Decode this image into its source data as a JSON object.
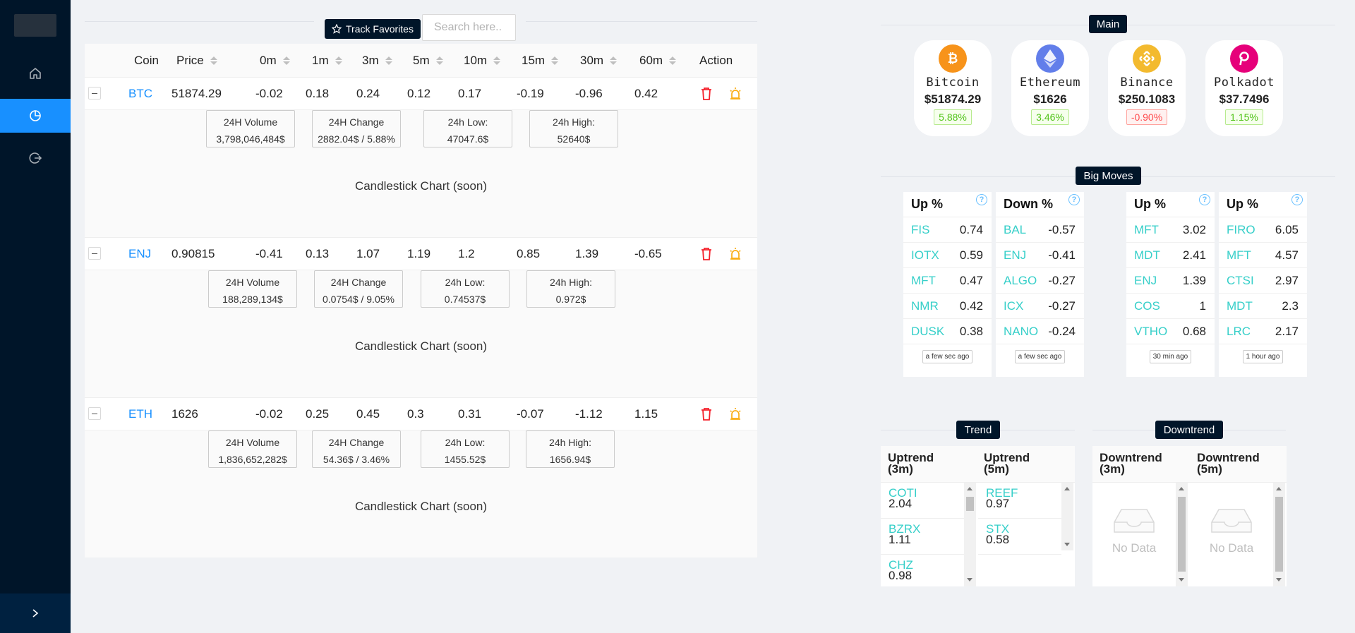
{
  "sidebar": {
    "items": [
      {
        "icon": "home-icon"
      },
      {
        "icon": "pie-chart-icon"
      },
      {
        "icon": "logout-icon"
      }
    ],
    "trigger_icon": "chevron-right-icon"
  },
  "toolbar": {
    "track_label": "Track Favorites",
    "search_placeholder": "Search here.."
  },
  "table": {
    "headers": {
      "coin": "Coin",
      "price": "Price",
      "m0": "0m",
      "m1": "1m",
      "m3": "3m",
      "m5": "5m",
      "m10": "10m",
      "m15": "15m",
      "m30": "30m",
      "m60": "60m",
      "action": "Action"
    },
    "rows": [
      {
        "coin": "BTC",
        "price": "51874.29",
        "m0": "-0.02",
        "m1": "0.18",
        "m3": "0.24",
        "m5": "0.12",
        "m10": "0.17",
        "m15": "-0.19",
        "m30": "-0.96",
        "m60": "0.42",
        "stats": [
          {
            "label": "24H Volume",
            "value": "3,798,046,484$"
          },
          {
            "label": "24H Change",
            "value": "2882.04$ / 5.88%"
          },
          {
            "label": "24h Low:",
            "value": "47047.6$"
          },
          {
            "label": "24h High:",
            "value": "52640$"
          }
        ],
        "chart_label": "Candlestick Chart (soon)"
      },
      {
        "coin": "ENJ",
        "price": "0.90815",
        "m0": "-0.41",
        "m1": "0.13",
        "m3": "1.07",
        "m5": "1.19",
        "m10": "1.2",
        "m15": "0.85",
        "m30": "1.39",
        "m60": "-0.65",
        "stats": [
          {
            "label": "24H Volume",
            "value": "188,289,134$"
          },
          {
            "label": "24H Change",
            "value": "0.0754$ / 9.05%"
          },
          {
            "label": "24h Low:",
            "value": "0.74537$"
          },
          {
            "label": "24h High:",
            "value": "0.972$"
          }
        ],
        "chart_label": "Candlestick Chart (soon)"
      },
      {
        "coin": "ETH",
        "price": "1626",
        "m0": "-0.02",
        "m1": "0.25",
        "m3": "0.45",
        "m5": "0.3",
        "m10": "0.31",
        "m15": "-0.07",
        "m30": "-1.12",
        "m60": "1.15",
        "stats": [
          {
            "label": "24H Volume",
            "value": "1,836,652,282$"
          },
          {
            "label": "24H Change",
            "value": "54.36$ / 3.46%"
          },
          {
            "label": "24h Low:",
            "value": "1455.52$"
          },
          {
            "label": "24h High:",
            "value": "1656.94$"
          }
        ],
        "chart_label": "Candlestick Chart (soon)"
      }
    ]
  },
  "main": {
    "title": "Main",
    "coins": [
      {
        "name": "Bitcoin",
        "price": "$51874.29",
        "change": "5.88%",
        "color": "#f7931a"
      },
      {
        "name": "Ethereum",
        "price": "$1626",
        "change": "3.46%",
        "color": "#627eea"
      },
      {
        "name": "Binance",
        "price": "$250.1083",
        "change": "-0.90%",
        "color": "#f3ba2f"
      },
      {
        "name": "Polkadot",
        "price": "$37.7496",
        "change": "1.15%",
        "color": "#e6007a"
      }
    ]
  },
  "big_moves": {
    "title": "Big Moves",
    "cards": [
      {
        "title": "Up %",
        "rows": [
          [
            "FIS",
            "0.74"
          ],
          [
            "IOTX",
            "0.59"
          ],
          [
            "MFT",
            "0.47"
          ],
          [
            "NMR",
            "0.42"
          ],
          [
            "DUSK",
            "0.38"
          ]
        ],
        "time": "a few sec ago"
      },
      {
        "title": "Down %",
        "rows": [
          [
            "BAL",
            "-0.57"
          ],
          [
            "ENJ",
            "-0.41"
          ],
          [
            "ALGO",
            "-0.27"
          ],
          [
            "ICX",
            "-0.27"
          ],
          [
            "NANO",
            "-0.24"
          ]
        ],
        "time": "a few sec ago"
      },
      {
        "title": "Up %",
        "rows": [
          [
            "MFT",
            "3.02"
          ],
          [
            "MDT",
            "2.41"
          ],
          [
            "ENJ",
            "1.39"
          ],
          [
            "COS",
            "1"
          ],
          [
            "VTHO",
            "0.68"
          ]
        ],
        "time": "30 min ago"
      },
      {
        "title": "Up %",
        "rows": [
          [
            "FIRO",
            "6.05"
          ],
          [
            "MFT",
            "4.57"
          ],
          [
            "CTSI",
            "2.97"
          ],
          [
            "MDT",
            "2.3"
          ],
          [
            "LRC",
            "2.17"
          ]
        ],
        "time": "1 hour ago"
      }
    ],
    "help_glyph": "?"
  },
  "trend": {
    "title": "Trend",
    "columns": [
      {
        "title_l1": "Uptrend",
        "title_l2": "(3m)",
        "items": [
          [
            "COTI",
            "2.04"
          ],
          [
            "BZRX",
            "1.11"
          ],
          [
            "CHZ",
            "0.98"
          ]
        ]
      },
      {
        "title_l1": "Uptrend",
        "title_l2": "(5m)",
        "items": [
          [
            "REEF",
            "0.97"
          ],
          [
            "STX",
            "0.58"
          ]
        ]
      }
    ]
  },
  "downtrend": {
    "title": "Downtrend",
    "columns": [
      {
        "title_l1": "Downtrend",
        "title_l2": "(3m)",
        "empty": "No Data"
      },
      {
        "title_l1": "Downtrend",
        "title_l2": "(5m)",
        "empty": "No Data"
      }
    ]
  }
}
